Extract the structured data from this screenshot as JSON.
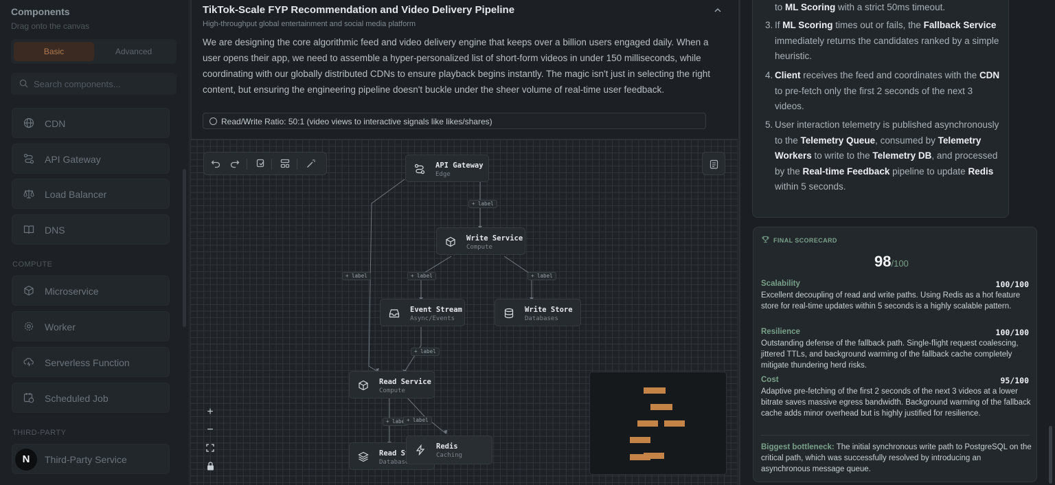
{
  "sidebar": {
    "title": "Components",
    "subtitle": "Drag onto the canvas",
    "tabs": [
      "Basic",
      "Advanced"
    ],
    "search_placeholder": "Search components...",
    "items_top": [
      "CDN",
      "API Gateway",
      "Load Balancer",
      "DNS"
    ],
    "section_compute": "COMPUTE",
    "items_compute": [
      "Microservice",
      "Worker",
      "Serverless Function",
      "Scheduled Job"
    ],
    "section_third_party": "THIRD-PARTY",
    "items_third_party": [
      "Third-Party Service"
    ],
    "third_party_avatar": "N"
  },
  "problem": {
    "title": "TikTok-Scale FYP Recommendation and Video Delivery Pipeline",
    "subtitle": "High-throughput global entertainment and social media platform",
    "description": "We are designing the core algorithmic feed and video delivery engine that keeps over a billion users engaged daily. When a user opens their app, we need to assemble a hyper-personalized list of short-form videos in under 150 milliseconds, while coordinating with our globally distributed CDNs to ensure playback begins instantly. The magic isn't just in selecting the right content, but ensuring the engineering pipeline doesn't buckle under the sheer volume of real-time user feedback.",
    "ratio": "Read/Write Ratio: 50:1 (video views to interactive signals like likes/shares)"
  },
  "canvas": {
    "nodes": {
      "api_gateway": {
        "title": "API Gateway",
        "sub": "Edge"
      },
      "write_service": {
        "title": "Write Service",
        "sub": "Compute"
      },
      "event_stream": {
        "title": "Event Stream",
        "sub": "Async/Events"
      },
      "write_store": {
        "title": "Write Store",
        "sub": "Databases"
      },
      "read_service": {
        "title": "Read Service",
        "sub": "Compute"
      },
      "read_store": {
        "title": "Read St",
        "sub": "Databases"
      },
      "redis": {
        "title": "Redis",
        "sub": "Caching"
      }
    },
    "edge_label": "+ label",
    "edge_label_cut": "+ labe",
    "zoom_in": "+",
    "zoom_out": "−"
  },
  "steps": [
    {
      "num": "",
      "lines": [
        [
          "",
          "to "
        ],
        [
          "b",
          "ML Scoring"
        ],
        [
          "",
          " with a strict 50ms timeout."
        ]
      ]
    },
    {
      "num": "3.",
      "lines": [
        [
          "",
          "If "
        ],
        [
          "b",
          "ML Scoring"
        ],
        [
          "",
          " times out or fails, the "
        ],
        [
          "b",
          "Fallback Service"
        ],
        [
          "",
          " immediately returns the candidates ranked by a simple heuristic."
        ]
      ]
    },
    {
      "num": "4.",
      "lines": [
        [
          "b",
          "Client"
        ],
        [
          "",
          " receives the feed and coordinates with the "
        ],
        [
          "b",
          "CDN"
        ],
        [
          "",
          " to pre-fetch only the first 2 seconds of the next 3 videos."
        ]
      ]
    },
    {
      "num": "5.",
      "lines": [
        [
          "",
          "User interaction telemetry is published asynchronously to the "
        ],
        [
          "b",
          "Telemetry Queue"
        ],
        [
          "",
          ", consumed by "
        ],
        [
          "b",
          "Telemetry Workers"
        ],
        [
          "",
          " to write to the "
        ],
        [
          "b",
          "Telemetry DB"
        ],
        [
          "",
          ", and processed by the "
        ],
        [
          "b",
          "Real-time Feedback"
        ],
        [
          "",
          " pipeline to update "
        ],
        [
          "b",
          "Redis"
        ],
        [
          "",
          " within 5 seconds."
        ]
      ]
    }
  ],
  "scorecard": {
    "heading": "FINAL SCORECARD",
    "score": "98",
    "out_of": "/100",
    "criteria": [
      {
        "name": "Scalability",
        "value": "100/100",
        "desc": "Excellent decoupling of read and write paths. Using Redis as a hot feature store for real-time updates within 5 seconds is a highly scalable pattern."
      },
      {
        "name": "Resilience",
        "value": "100/100",
        "desc": "Outstanding defense of the fallback path. Single-flight request coalescing, jittered TTLs, and background warming of the fallback cache completely mitigate thundering herd risks."
      },
      {
        "name": "Cost",
        "value": "95/100",
        "desc": "Adaptive pre-fetching of the first 2 seconds of the next 3 videos at a lower bitrate saves massive egress bandwidth. Background warming of the fallback cache adds minor overhead but is highly justified for resilience."
      }
    ],
    "bottleneck_label": "Biggest bottleneck:",
    "bottleneck_text": " The initial synchronous write path to PostgreSQL on the critical path, which was successfully resolved by introducing an asynchronous message queue."
  },
  "colors": {
    "accent": "#c48347",
    "score_green": "#7aa08a",
    "bg": "#1b1f23"
  }
}
